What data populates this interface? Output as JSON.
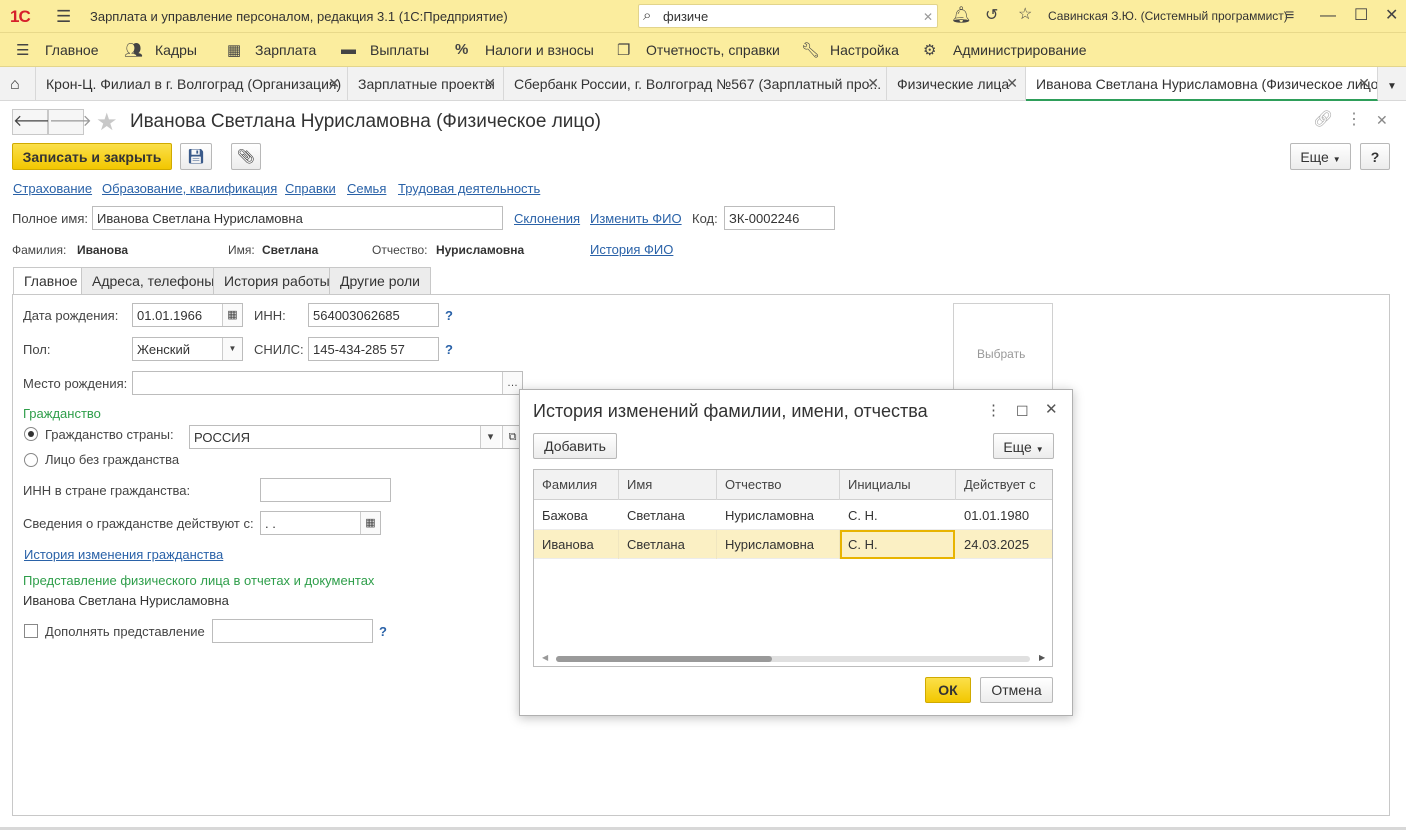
{
  "app": {
    "logo": "1С",
    "title": "Зарплата и управление персоналом, редакция 3.1  (1С:Предприятие)",
    "search_value": "физиче",
    "user": "Савинская З.Ю. (Системный программист)"
  },
  "menu": {
    "items": [
      {
        "label": "Главное",
        "icon": "menu-icon"
      },
      {
        "label": "Кадры",
        "icon": "people-icon"
      },
      {
        "label": "Зарплата",
        "icon": "calculator-icon"
      },
      {
        "label": "Выплаты",
        "icon": "wallet-icon"
      },
      {
        "label": "Налоги и взносы",
        "icon": "percent-icon"
      },
      {
        "label": "Отчетность, справки",
        "icon": "reports-icon"
      },
      {
        "label": "Настройка",
        "icon": "wrench-icon"
      },
      {
        "label": "Администрирование",
        "icon": "gear-icon"
      }
    ],
    "percent_glyph": "%"
  },
  "tabs": [
    {
      "label": "Крон-Ц. Филиал в г. Волгоград (Организация)"
    },
    {
      "label": "Зарплатные проекты"
    },
    {
      "label": "Сбербанк России, г. Волгоград №567 (Зарплатный про..."
    },
    {
      "label": "Физические лица"
    },
    {
      "label": "Иванова Светлана Нурисламовна (Физическое лицо)"
    }
  ],
  "form": {
    "title": "Иванова Светлана Нурисламовна (Физическое лицо)",
    "save_close_label": "Записать и закрыть",
    "more_label": "Еще",
    "help_label": "?",
    "links": [
      "Страхование",
      "Образование, квалификация",
      "Справки",
      "Семья",
      "Трудовая деятельность"
    ],
    "full_name_label": "Полное имя:",
    "full_name_value": "Иванова Светлана Нурисламовна",
    "declensions_link": "Склонения",
    "change_fio_link": "Изменить ФИО",
    "code_label": "Код:",
    "code_value": "ЗК-0002246",
    "surname_label": "Фамилия:",
    "surname_value": "Иванова",
    "name_label": "Имя:",
    "name_value": "Светлана",
    "patronymic_label": "Отчество:",
    "patronymic_value": "Нурисламовна",
    "fio_history_link": "История ФИО"
  },
  "subtabs": [
    "Главное",
    "Адреса, телефоны",
    "История работы",
    "Другие роли"
  ],
  "main": {
    "birth_date_label": "Дата рождения:",
    "birth_date_value": "01.01.1966",
    "inn_label": "ИНН:",
    "inn_value": "564003062685",
    "gender_label": "Пол:",
    "gender_value": "Женский",
    "snils_label": "СНИЛС:",
    "snils_value": "145-434-285 57",
    "birth_place_label": "Место рождения:",
    "birth_place_value": "",
    "photo_select": "Выбрать",
    "citizenship_header": "Гражданство",
    "citizenship_country_label": "Гражданство страны:",
    "citizenship_country_value": "РОССИЯ",
    "stateless_label": "Лицо без гражданства",
    "foreign_inn_label": "ИНН в стране гражданства:",
    "citizenship_since_label": "Сведения о гражданстве действуют с:",
    "citizenship_since_value": " .  .",
    "citizenship_history_link": "История изменения гражданства",
    "representation_header": "Представление физического лица в отчетах и документах",
    "representation_value": "Иванова Светлана Нурисламовна",
    "supplement_label": "Дополнять представление",
    "question": "?"
  },
  "dialog": {
    "title": "История изменений фамилии, имени, отчества",
    "add_label": "Добавить",
    "more_label": "Еще",
    "ok_label": "ОК",
    "cancel_label": "Отмена",
    "columns": [
      "Фамилия",
      "Имя",
      "Отчество",
      "Инициалы",
      "Действует с"
    ],
    "rows": [
      [
        "Бажова",
        "Светлана",
        "Нурисламовна",
        "С. Н.",
        "01.01.1980"
      ],
      [
        "Иванова",
        "Светлана",
        "Нурисламовна",
        "С. Н.",
        "24.03.2025"
      ]
    ]
  }
}
